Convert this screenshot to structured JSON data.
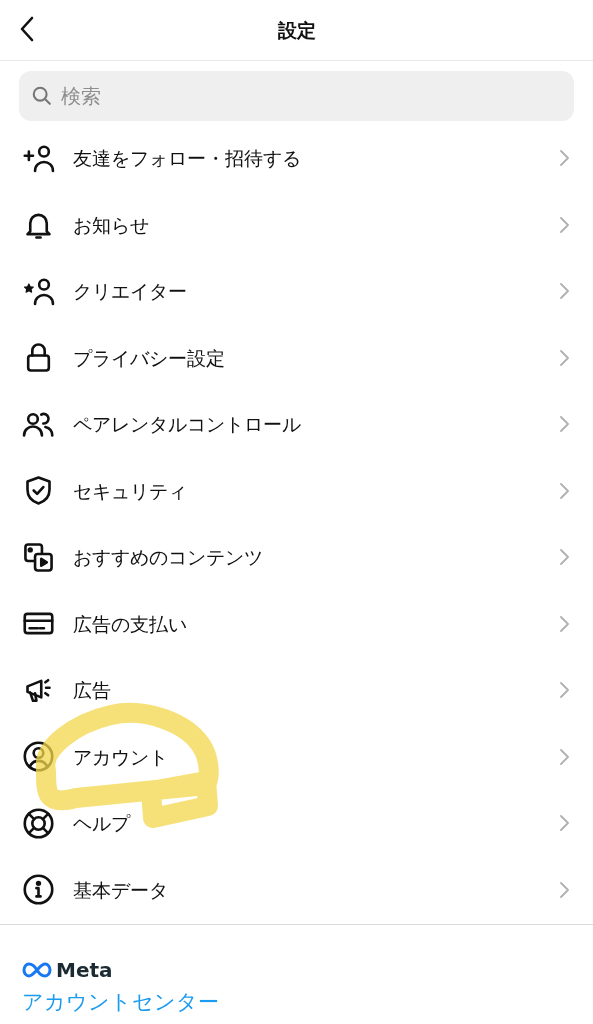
{
  "header": {
    "title": "設定"
  },
  "search": {
    "placeholder": "検索"
  },
  "items": [
    {
      "label": "友達をフォロー・招待する"
    },
    {
      "label": "お知らせ"
    },
    {
      "label": "クリエイター"
    },
    {
      "label": "プライバシー設定"
    },
    {
      "label": "ペアレンタルコントロール"
    },
    {
      "label": "セキュリティ"
    },
    {
      "label": "おすすめのコンテンツ"
    },
    {
      "label": "広告の支払い"
    },
    {
      "label": "広告"
    },
    {
      "label": "アカウント"
    },
    {
      "label": "ヘルプ"
    },
    {
      "label": "基本データ"
    }
  ],
  "footer": {
    "brand": "Meta",
    "link": "アカウントセンター"
  }
}
